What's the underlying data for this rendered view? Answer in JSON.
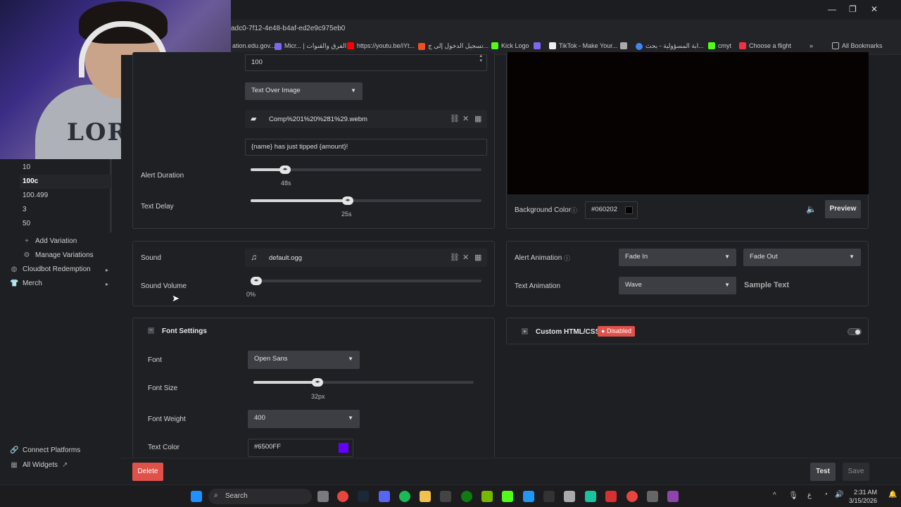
{
  "browser": {
    "url": "adc0-7f12-4e48-b4af-ed2e9c975eb0",
    "bookmarks": [
      {
        "label": "ation.edu.gov...",
        "color": "#888"
      },
      {
        "label": "Micr... | الفرق والقنوات",
        "color": "#7b68ee"
      },
      {
        "label": "https://youtu.be/iYt...",
        "color": "#ff0000"
      },
      {
        "label": "تسجيل الدخول إلى ج...",
        "color": "#f25022"
      },
      {
        "label": "Kick Logo",
        "color": "#53fc18"
      },
      {
        "label": "",
        "color": "#7b68ee"
      },
      {
        "label": "TikTok - Make Your...",
        "color": "#eee"
      },
      {
        "label": "",
        "color": "#aaa"
      },
      {
        "label": "ابة المسؤولية - بحث...",
        "color": "#4285f4"
      },
      {
        "label": "cmyt",
        "color": "#53fc18"
      },
      {
        "label": "Choose a flight",
        "color": "#e34"
      }
    ],
    "all_bookmarks": "All Bookmarks"
  },
  "sidebar": {
    "variations": [
      "10",
      "100c",
      "100.499",
      "3",
      "50"
    ],
    "active_variation": "100c",
    "add_variation": "Add Variation",
    "manage_variations": "Manage Variations",
    "cloudbot_redemption": "Cloudbot Redemption",
    "merch": "Merch",
    "connect_platforms": "Connect Platforms",
    "all_widgets": "All Widgets"
  },
  "alert": {
    "amount_value": "100",
    "layout": "Text Over Image",
    "media_file": "Comp%201%20%281%29.webm",
    "message_template": "{name} has just tipped {amount}!",
    "alert_duration_label": "Alert Duration",
    "alert_duration_value": "48s",
    "alert_duration_fraction": 0.15,
    "text_delay_label": "Text Delay",
    "text_delay_value": "25s",
    "text_delay_fraction": 0.42
  },
  "sound": {
    "label": "Sound",
    "file": "default.ogg",
    "volume_label": "Sound Volume",
    "volume_value": "0%",
    "volume_fraction": 0.0
  },
  "font_settings": {
    "title": "Font Settings",
    "font_label": "Font",
    "font_value": "Open Sans",
    "size_label": "Font Size",
    "size_value": "32px",
    "size_fraction": 0.29,
    "weight_label": "Font Weight",
    "weight_value": "400",
    "color_label": "Text Color",
    "color_value": "#6500FF",
    "color_swatch": "#6500FF"
  },
  "preview": {
    "background_color_label": "Background Color",
    "background_color_value": "#060202",
    "background_swatch": "#060202",
    "preview_button": "Preview"
  },
  "animation": {
    "alert_animation_label": "Alert Animation",
    "alert_in": "Fade In",
    "alert_out": "Fade Out",
    "text_animation_label": "Text Animation",
    "text_animation": "Wave",
    "sample_text": "Sample Text"
  },
  "custom": {
    "title": "Custom HTML/CSS",
    "status": "Disabled"
  },
  "footer": {
    "delete": "Delete",
    "test": "Test",
    "save": "Save"
  },
  "taskbar": {
    "search": "Search",
    "time": "2:31 AM",
    "date": "3/15/2026",
    "lang": "ع"
  },
  "colors": {
    "accent_red": "#e0514a",
    "disabled_badge": "#e0514a"
  }
}
